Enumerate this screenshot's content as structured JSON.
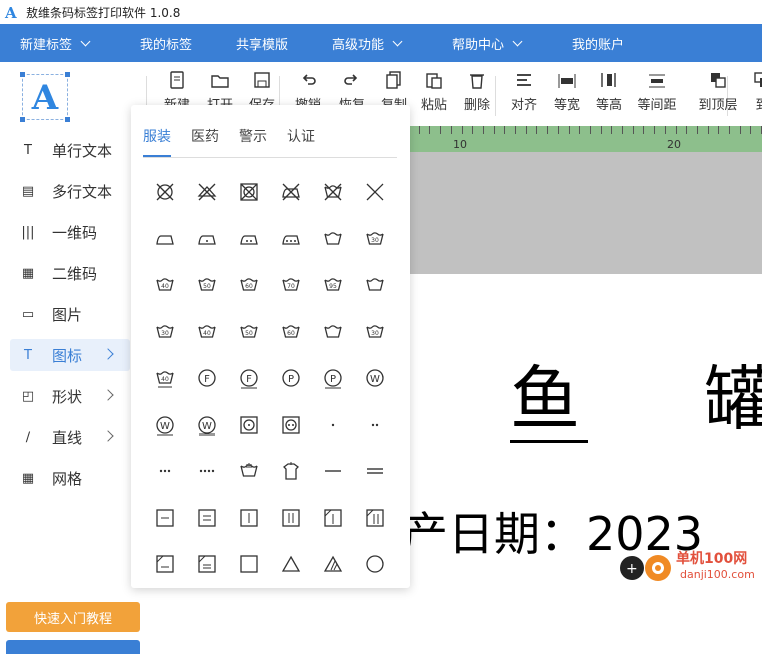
{
  "window": {
    "title": "敖维条码标签打印软件 1.0.8"
  },
  "menu": [
    {
      "label": "新建标签",
      "dropdown": true
    },
    {
      "label": "我的标签",
      "dropdown": false
    },
    {
      "label": "共享模版",
      "dropdown": false
    },
    {
      "label": "高级功能",
      "dropdown": true
    },
    {
      "label": "帮助中心",
      "dropdown": true
    },
    {
      "label": "我的账户",
      "dropdown": false
    }
  ],
  "sidebar": {
    "logo_letter": "A",
    "items": [
      {
        "label": "单行文本",
        "icon": "text-icon",
        "glyph": "T",
        "submenu": false,
        "active": false
      },
      {
        "label": "多行文本",
        "icon": "multiline-text-icon",
        "glyph": "▤",
        "submenu": false,
        "active": false
      },
      {
        "label": "一维码",
        "icon": "barcode-icon",
        "glyph": "|||",
        "submenu": false,
        "active": false
      },
      {
        "label": "二维码",
        "icon": "qrcode-icon",
        "glyph": "▦",
        "submenu": false,
        "active": false
      },
      {
        "label": "图片",
        "icon": "image-icon",
        "glyph": "▭",
        "submenu": false,
        "active": false
      },
      {
        "label": "图标",
        "icon": "icon-library-icon",
        "glyph": "T",
        "submenu": true,
        "active": true
      },
      {
        "label": "形状",
        "icon": "shape-icon",
        "glyph": "◰",
        "submenu": true,
        "active": false
      },
      {
        "label": "直线",
        "icon": "line-icon",
        "glyph": "∕",
        "submenu": true,
        "active": false
      },
      {
        "label": "网格",
        "icon": "grid-icon",
        "glyph": "▦",
        "submenu": false,
        "active": false
      }
    ],
    "tutorial_button": "快速入门教程"
  },
  "toolbar": [
    {
      "label": "新建",
      "icon": "new-file-icon"
    },
    {
      "label": "打开",
      "icon": "open-folder-icon"
    },
    {
      "label": "保存",
      "icon": "save-icon"
    },
    {
      "label": "撤销",
      "icon": "undo-icon"
    },
    {
      "label": "恢复",
      "icon": "redo-icon"
    },
    {
      "label": "复制",
      "icon": "copy-icon"
    },
    {
      "label": "粘贴",
      "icon": "paste-icon"
    },
    {
      "label": "删除",
      "icon": "delete-icon"
    },
    {
      "label": "对齐",
      "icon": "align-icon"
    },
    {
      "label": "等宽",
      "icon": "equal-width-icon"
    },
    {
      "label": "等高",
      "icon": "equal-height-icon"
    },
    {
      "label": "等间距",
      "icon": "equal-spacing-icon"
    },
    {
      "label": "到顶层",
      "icon": "bring-to-front-icon"
    },
    {
      "label": "到",
      "icon": "send-to-back-icon"
    }
  ],
  "canvas": {
    "ruler_labels": [
      "10",
      "20"
    ],
    "label_chars": [
      "鱼",
      "罐"
    ],
    "date_text": "产日期：2023"
  },
  "icon_panel": {
    "tabs": [
      {
        "label": "服装",
        "active": true
      },
      {
        "label": "医药",
        "active": false
      },
      {
        "label": "警示",
        "active": false
      },
      {
        "label": "认证",
        "active": false
      }
    ],
    "icons": [
      "no-tumble-dry-icon",
      "no-iron-icon",
      "no-dry-clean-icon",
      "do-not-iron-icon",
      "no-wash-icon",
      "no-bleach-icon",
      "iron-low-icon",
      "iron-medium-icon",
      "iron-high-icon",
      "iron-very-high-icon",
      "wash-tub-icon",
      "wash-30-icon",
      "wash-40-icon",
      "wash-50-icon",
      "wash-60-icon",
      "wash-70-icon",
      "wash-95-icon",
      "gentle-wash-icon",
      "wash-30-gentle-icon",
      "wash-40-gentle-icon",
      "wash-50-gentle-icon",
      "wash-60-gentle-icon",
      "wash-tub-gentle-icon",
      "wash-30-double-icon",
      "wash-40-double-icon",
      "dry-clean-f-icon",
      "dry-clean-f-gentle-icon",
      "dry-clean-p-icon",
      "dry-clean-p-gentle-icon",
      "wet-clean-icon",
      "wet-clean-gentle-icon",
      "wet-clean-very-gentle-icon",
      "tumble-dry-low-icon",
      "tumble-dry-normal-icon",
      "one-dot-icon",
      "two-dot-icon",
      "three-dot-icon",
      "four-dot-icon",
      "hand-wash-icon",
      "hang-dry-icon",
      "flat-dash-icon",
      "double-dash-icon",
      "line-dry-icon",
      "drip-dry-icon",
      "dry-flat-icon",
      "double-dry-flat-icon",
      "shade-dry-icon",
      "shade-line-dry-icon",
      "shade-drip-dry-icon",
      "shade-flat-dry-icon",
      "tumble-dry-square-icon",
      "bleach-triangle-icon",
      "non-chlorine-bleach-icon",
      "dry-circle-icon"
    ]
  },
  "watermark": {
    "text": "单机100网",
    "sub": "danji100.com"
  }
}
